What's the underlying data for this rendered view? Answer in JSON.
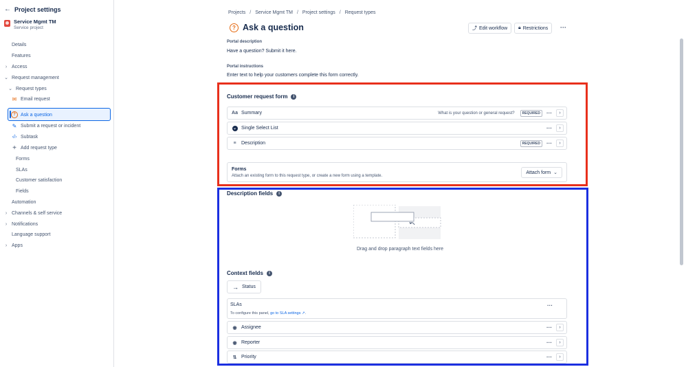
{
  "sidebar": {
    "back_label": "Project settings",
    "project_name": "Service Mgmt TM",
    "project_type": "Service project",
    "items": [
      {
        "label": "Details"
      },
      {
        "label": "Features"
      },
      {
        "label": "Access"
      },
      {
        "label": "Request management"
      },
      {
        "label": "Request types"
      },
      {
        "label": "Email request"
      },
      {
        "label": "Ask a question"
      },
      {
        "label": "Submit a request or incident"
      },
      {
        "label": "Subtask"
      },
      {
        "label": "Add request type"
      },
      {
        "label": "Forms"
      },
      {
        "label": "SLAs"
      },
      {
        "label": "Customer satisfaction"
      },
      {
        "label": "Fields"
      },
      {
        "label": "Automation"
      },
      {
        "label": "Channels & self service"
      },
      {
        "label": "Notifications"
      },
      {
        "label": "Language support"
      },
      {
        "label": "Apps"
      }
    ]
  },
  "breadcrumb": [
    "Projects",
    "Service Mgmt TM",
    "Project settings",
    "Request types"
  ],
  "page_title": "Ask a question",
  "header_buttons": {
    "edit_workflow": "Edit workflow",
    "restrictions": "Restrictions"
  },
  "portal": {
    "description_label": "Portal description",
    "description_value": "Have a question? Submit it here.",
    "instructions_label": "Portal instructions",
    "instructions_value": "Enter text to help your customers complete this form correctly."
  },
  "customer_form": {
    "title": "Customer request form",
    "fields": [
      {
        "icon": "Aa",
        "label": "Summary",
        "hint": "What is your question or general request?",
        "required": "REQUIRED"
      },
      {
        "icon": "⌄",
        "label": "Single Select List",
        "hint": "",
        "required": ""
      },
      {
        "icon": "≡",
        "label": "Description",
        "hint": "",
        "required": "REQUIRED"
      }
    ],
    "forms_title": "Forms",
    "forms_desc": "Attach an existing form to this request type, or create a new form using a template.",
    "attach_label": "Attach form"
  },
  "description_fields": {
    "title": "Description fields",
    "drop_hint": "Drag and drop paragraph text fields here"
  },
  "context_fields": {
    "title": "Context fields",
    "status_label": "Status",
    "sla_title": "SLAs",
    "sla_desc": "To configure this panel,",
    "sla_link": "go to SLA settings",
    "sla_desc_end": ".",
    "rows": [
      {
        "label": "Assignee"
      },
      {
        "label": "Reporter"
      },
      {
        "label": "Priority"
      }
    ]
  },
  "colors": {
    "accent": "#0c66e4",
    "red_highlight": "#e8301c",
    "blue_highlight": "#1b2fe0"
  }
}
